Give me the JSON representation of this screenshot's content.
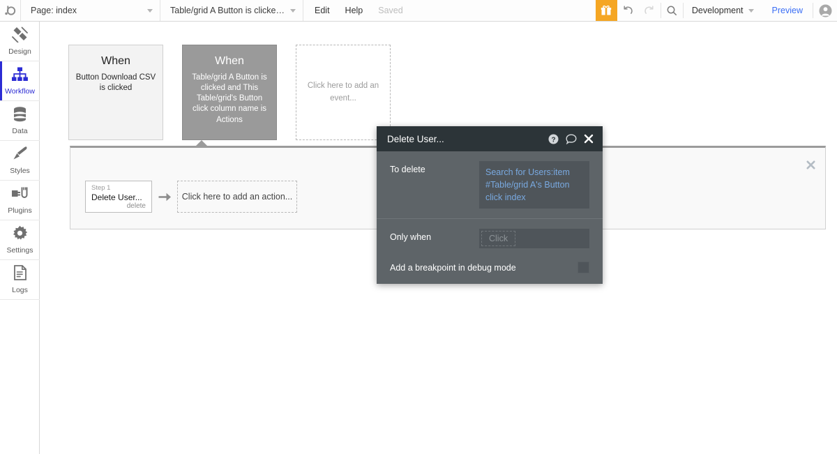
{
  "topbar": {
    "logo_icon": "bubble-logo-icon",
    "page_label": "Page: index",
    "workflow_label": "Table/grid A Button is clicked an...",
    "edit_label": "Edit",
    "help_label": "Help",
    "saved_label": "Saved",
    "gift_icon": "gift-icon",
    "undo_icon": "undo-icon",
    "redo_icon": "redo-icon",
    "search_icon": "search-icon",
    "version_label": "Development",
    "preview_label": "Preview",
    "avatar_icon": "user-avatar-icon",
    "accent_color": "#3b6ef5",
    "gift_color": "#f5a623"
  },
  "sidebar": {
    "items": [
      {
        "label": "Design",
        "icon": "design-icon",
        "active": false
      },
      {
        "label": "Workflow",
        "icon": "workflow-icon",
        "active": true
      },
      {
        "label": "Data",
        "icon": "data-icon",
        "active": false
      },
      {
        "label": "Styles",
        "icon": "styles-icon",
        "active": false
      },
      {
        "label": "Plugins",
        "icon": "plugins-icon",
        "active": false
      },
      {
        "label": "Settings",
        "icon": "settings-icon",
        "active": false
      },
      {
        "label": "Logs",
        "icon": "logs-icon",
        "active": false
      }
    ],
    "expand_icon": "expand-right-icon",
    "active_color": "#2c2cd4"
  },
  "workflow": {
    "events": [
      {
        "when": "When",
        "description": "Button Download CSV is clicked",
        "state": "plain"
      },
      {
        "when": "When",
        "description": "Table/grid A Button is clicked and This Table/grid's Button click column name is Actions",
        "state": "selected"
      },
      {
        "placeholder": "Click here to add an event...",
        "state": "empty"
      }
    ],
    "panel": {
      "close_icon": "close-icon",
      "steps": [
        {
          "number": "Step 1",
          "title": "Delete User...",
          "subtitle": "delete"
        }
      ],
      "arrow_icon": "arrow-right-icon",
      "add_action_label": "Click here to add an action..."
    }
  },
  "modal": {
    "title": "Delete User...",
    "help_icon": "help-circle-icon",
    "comment_icon": "comment-icon",
    "close_icon": "close-icon",
    "fields": [
      {
        "label": "To delete",
        "value": "Search for Users:item #Table/grid A's Button click index",
        "value_color": "#79a9e0"
      },
      {
        "label": "Only when",
        "placeholder": "Click"
      }
    ],
    "breakpoint_label": "Add a breakpoint in debug mode",
    "breakpoint_checked": false
  }
}
